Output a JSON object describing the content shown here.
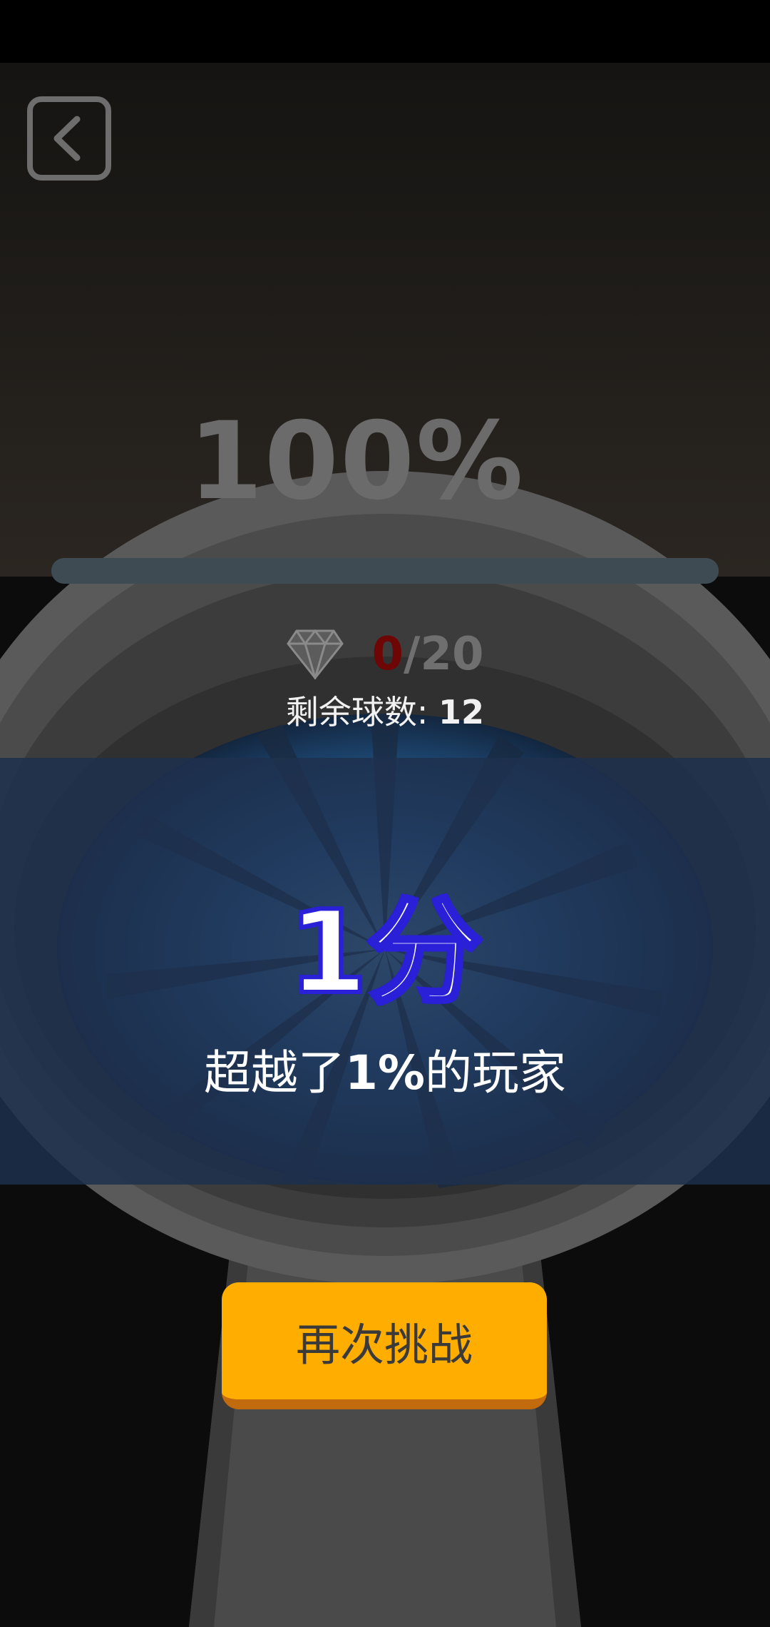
{
  "header": {
    "back_icon": "chevron-left-icon"
  },
  "progress": {
    "percent_label": "100%",
    "value": 1.0
  },
  "gems": {
    "icon": "diamond-icon",
    "collected": "0",
    "separator": "/",
    "total": "20"
  },
  "balls": {
    "label": "剩余球数: ",
    "value": "12"
  },
  "result": {
    "score": "1分",
    "rank_prefix": "超越了",
    "rank_value": "1%",
    "rank_suffix": "的玩家"
  },
  "actions": {
    "retry_label": "再次挑战"
  },
  "colors": {
    "retry_button": "#ffae00",
    "gem_current": "#6e0606",
    "panel": "#1e304e",
    "score_stroke": "#2a20d8"
  }
}
